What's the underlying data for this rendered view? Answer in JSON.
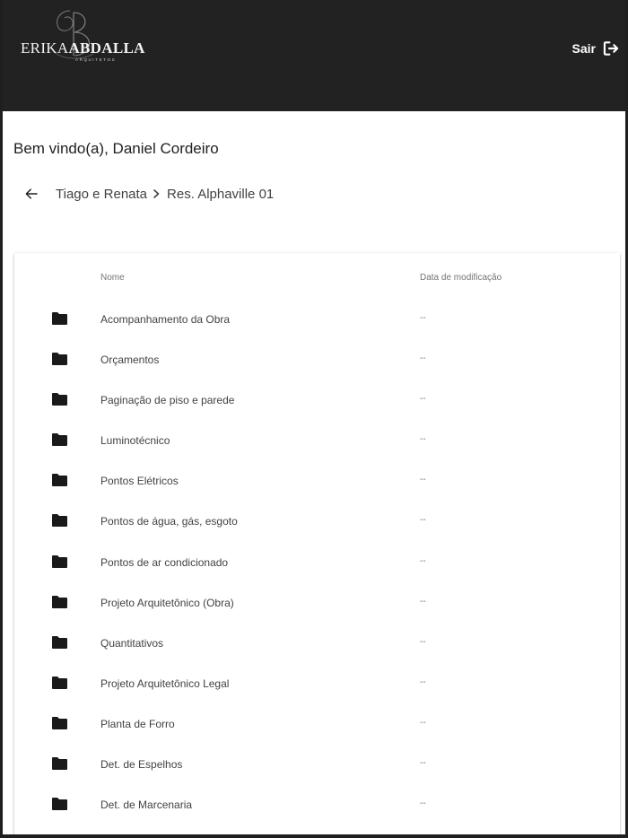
{
  "header": {
    "logo": {
      "first": "ERIKA",
      "last": "ABDALLA",
      "sub": "ARQUITETOS"
    },
    "logout_label": "Sair",
    "background": "#222222"
  },
  "welcome": "Bem vindo(a), Daniel Cordeiro",
  "breadcrumb": {
    "items": [
      "Tiago e Renata",
      "Res. Alphaville 01"
    ]
  },
  "table": {
    "columns": {
      "name": "Nome",
      "modified": "Data de modificação"
    },
    "rows": [
      {
        "name": "Acompanhamento da Obra",
        "modified": "--"
      },
      {
        "name": "Orçamentos",
        "modified": "--"
      },
      {
        "name": "Paginação de piso e parede",
        "modified": "--"
      },
      {
        "name": "Luminotécnico",
        "modified": "--"
      },
      {
        "name": "Pontos Elétricos",
        "modified": "--"
      },
      {
        "name": "Pontos de água, gás, esgoto",
        "modified": "--"
      },
      {
        "name": "Pontos de ar condicionado",
        "modified": "--"
      },
      {
        "name": "Projeto Arquitetônico (Obra)",
        "modified": "--"
      },
      {
        "name": "Quantitativos",
        "modified": "--"
      },
      {
        "name": "Projeto Arquitetônico Legal",
        "modified": "--"
      },
      {
        "name": "Planta de Forro",
        "modified": "--"
      },
      {
        "name": "Det. de Espelhos",
        "modified": "--"
      },
      {
        "name": "Det. de Marcenaria",
        "modified": "--"
      }
    ],
    "row_icon": "folder-icon"
  }
}
